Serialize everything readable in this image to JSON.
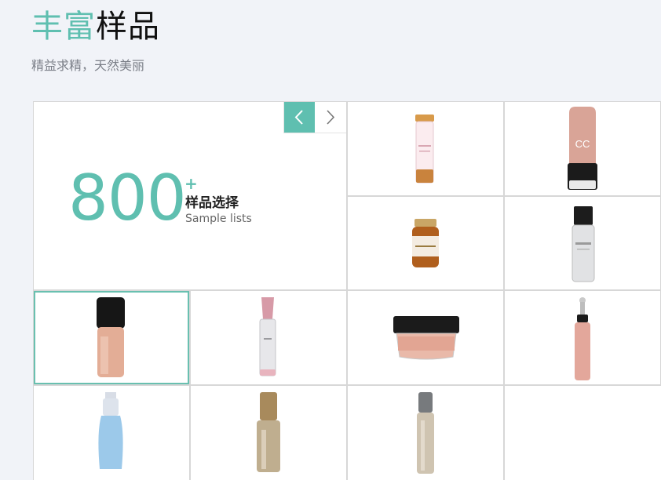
{
  "header": {
    "title_accent": "丰富",
    "title_rest": "样品",
    "subtitle": "精益求精，天然美丽"
  },
  "feature": {
    "count": "800",
    "plus": "+",
    "label": "样品选择",
    "sublabel": "Sample lists",
    "prev_icon": "chevron-left-icon",
    "next_icon": "chevron-right-icon"
  },
  "products": [
    {
      "name": "pink-label-vial"
    },
    {
      "name": "pink-cc-cream-tube",
      "label": "CC"
    },
    {
      "name": "amber-serum-bottle"
    },
    {
      "name": "silver-mousse-pump"
    },
    {
      "name": "nude-foundation-bottle",
      "selected": true
    },
    {
      "name": "pink-silver-essence-bottle"
    },
    {
      "name": "pink-cream-jar"
    },
    {
      "name": "pink-eye-serum-applicator"
    },
    {
      "name": "blue-lotion-pump-bottle"
    },
    {
      "name": "gold-toner-bottle"
    },
    {
      "name": "champagne-serum-bottle"
    }
  ],
  "colors": {
    "accent": "#5fbfb0",
    "selected_border": "#69c0b0",
    "background": "#f1f3f8"
  }
}
